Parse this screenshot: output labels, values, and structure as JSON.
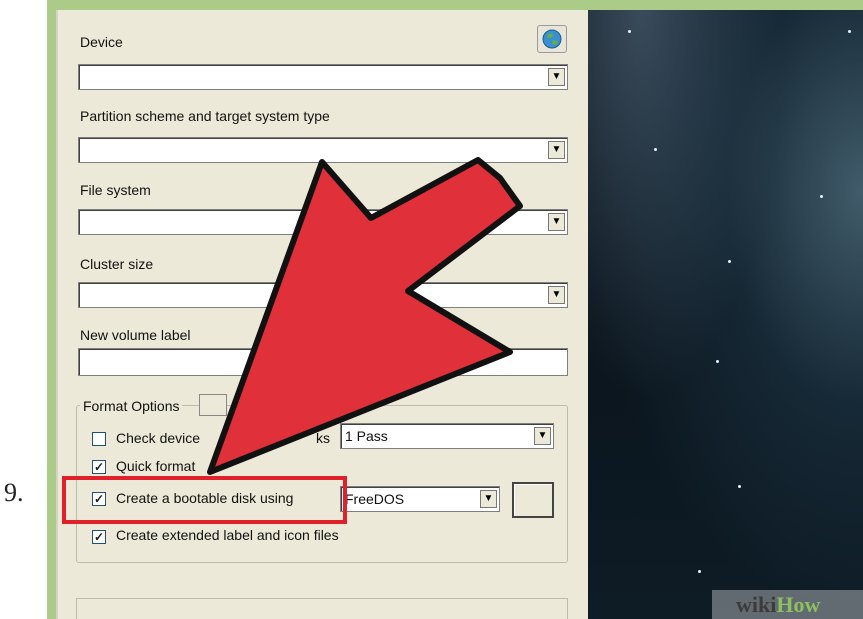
{
  "step": {
    "number": "9."
  },
  "form": {
    "device_label": "Device",
    "device_value": "",
    "partition_label": "Partition scheme and target system type",
    "partition_value": "",
    "filesystem_label": "File system",
    "filesystem_value": "",
    "cluster_label": "Cluster size",
    "cluster_value": "",
    "volume_label": "New volume label",
    "volume_value": ""
  },
  "format_options": {
    "title": "Format Options",
    "check_device_label_visible": "Check device",
    "check_device_label_tail": "ks",
    "check_device_checked": false,
    "passes_value": "1 Pass",
    "quick_format_label": "Quick format",
    "quick_format_checked": true,
    "bootable_label": "Create a bootable disk using",
    "bootable_checked": true,
    "bootable_value": "FreeDOS",
    "extended_label": "Create extended label and icon files",
    "extended_checked": true
  },
  "icons": {
    "globe": "globe-icon",
    "dropdown": "chevron-down-icon",
    "checkmark": "checkmark-icon"
  },
  "annotation": {
    "highlight_color": "#e0202a",
    "arrow_color": "#e0303a"
  },
  "watermark": {
    "part_a": "wiki",
    "part_b": "How"
  }
}
